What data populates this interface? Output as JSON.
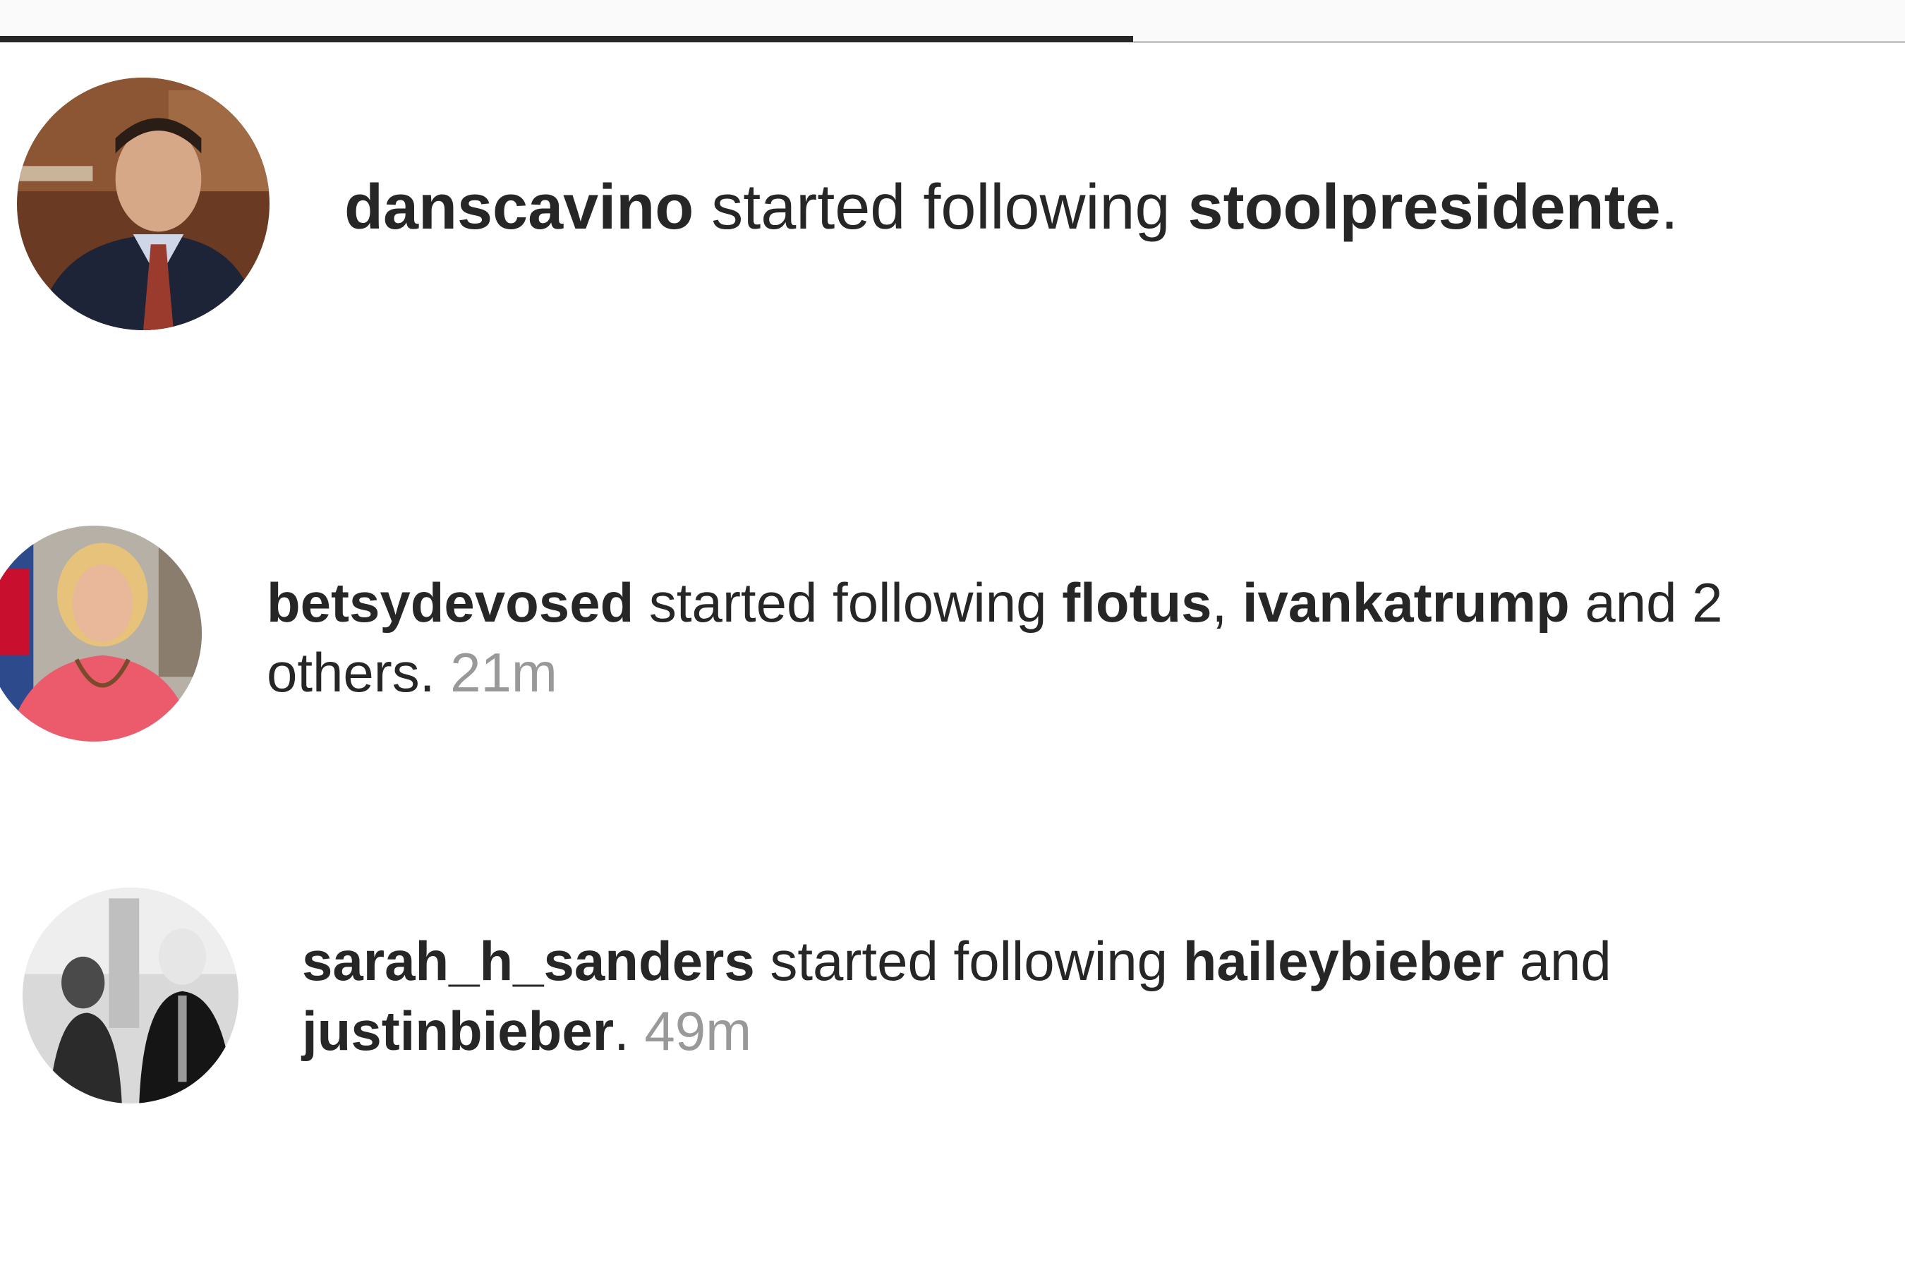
{
  "notifications": [
    {
      "user": "danscavino",
      "action": " started following ",
      "targets": [
        "stoolpresidente"
      ],
      "joiner1": "",
      "joiner2": "",
      "tail": ".",
      "time": ""
    },
    {
      "user": "betsydevosed",
      "action": " started following ",
      "targets": [
        "flotus",
        "ivankatrump"
      ],
      "joiner1": ", ",
      "joiner2": " and 2 others. ",
      "tail": "",
      "time": "21m"
    },
    {
      "user": "sarah_h_sanders",
      "action": " started following ",
      "targets": [
        "haileybieber",
        "justinbieber"
      ],
      "joiner1": " and ",
      "joiner2": ". ",
      "tail": "",
      "time": "49m"
    }
  ],
  "avatar_icons": [
    "avatar-photo",
    "avatar-photo",
    "avatar-photo-grayscale"
  ]
}
